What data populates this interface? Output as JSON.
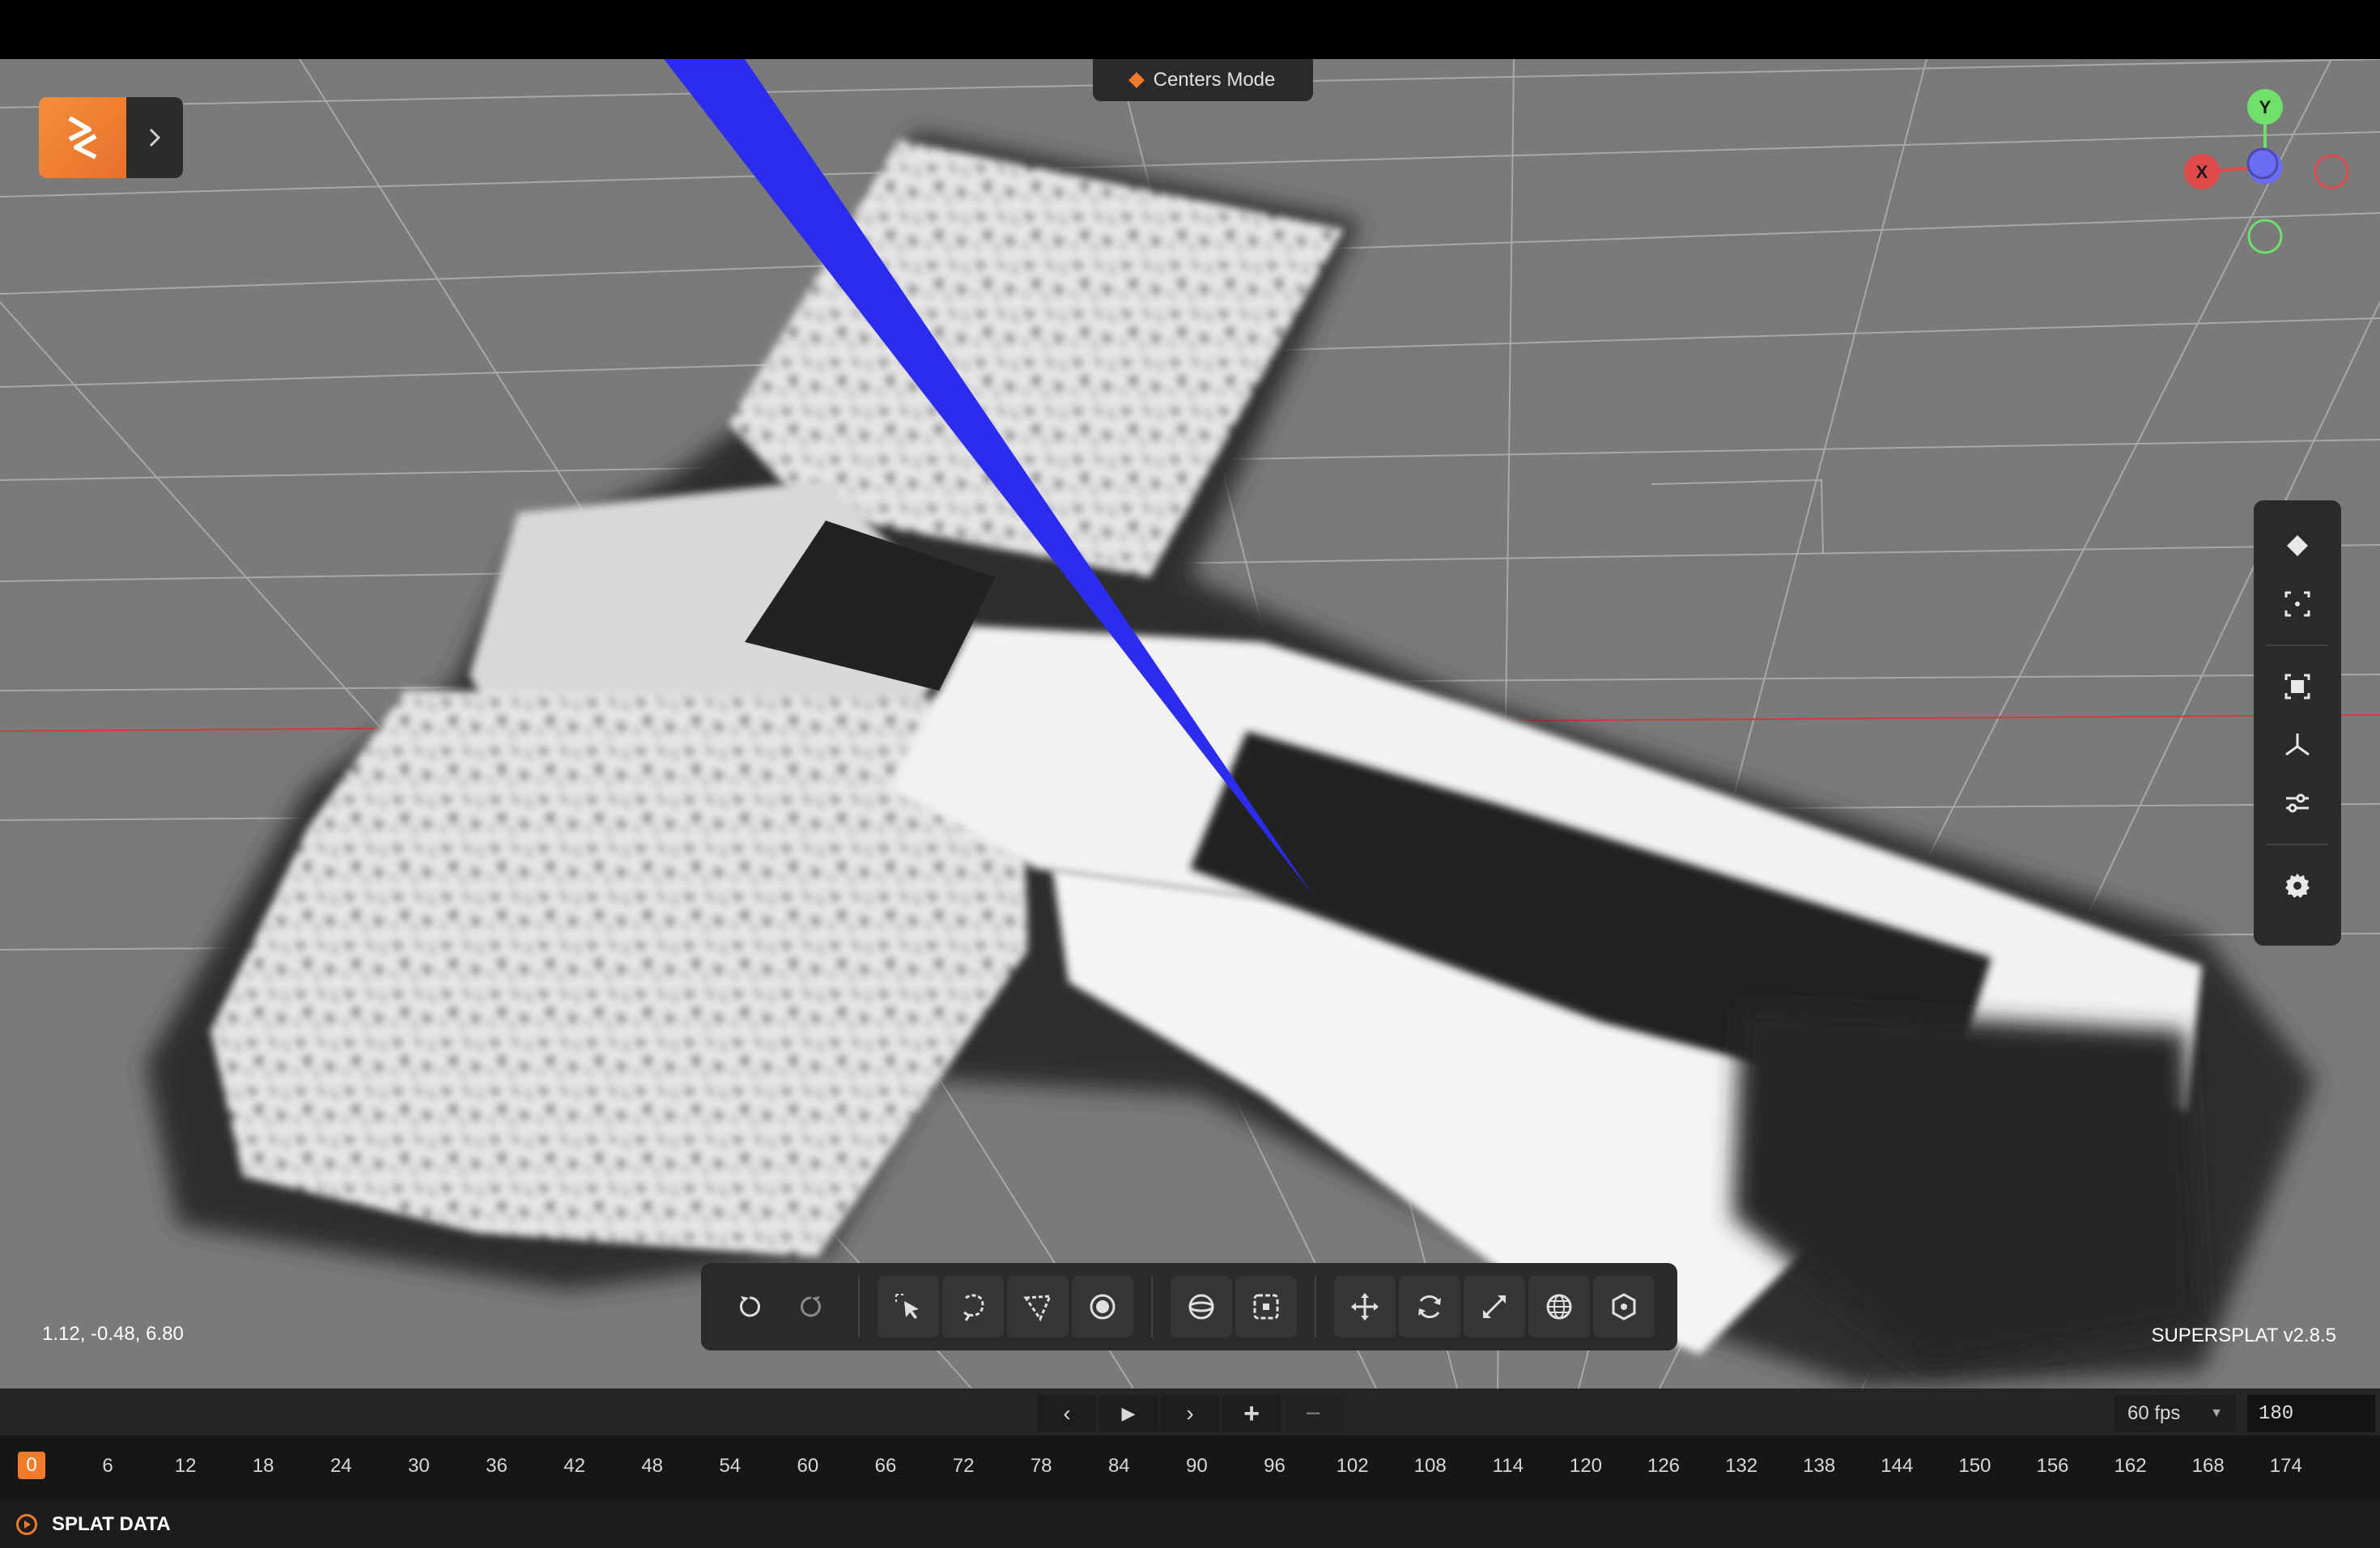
{
  "app": {
    "version_label": "SUPERSPLAT v2.8.5"
  },
  "mode": {
    "label": "Centers Mode"
  },
  "viewport": {
    "coordinates": "1.12, -0.48, 6.80"
  },
  "gizmo": {
    "x_label": "X",
    "y_label": "Y",
    "z_label": ""
  },
  "colors": {
    "accent": "#f07b2a",
    "panel": "#2a2a2a",
    "viewport_bg": "#7a7a7a",
    "ray": "#2b2cf0",
    "gizmo_x": "#e04a4a",
    "gizmo_y": "#6fe06a",
    "gizmo_z": "#6b6ef2"
  },
  "right_panel": {
    "items": [
      "keyframe-icon",
      "frame-selection-icon",
      "focus-icon",
      "axes-icon",
      "sliders-icon",
      "settings-icon"
    ]
  },
  "toolbar": {
    "items": [
      "undo-icon",
      "redo-icon",
      "pick-select-icon",
      "lasso-select-icon",
      "polygon-select-icon",
      "brush-select-icon",
      "sphere-select-icon",
      "box-select-icon",
      "translate-icon",
      "rotate-icon",
      "scale-icon",
      "world-space-icon",
      "bound-icon"
    ]
  },
  "timeline": {
    "prev_label": "‹",
    "play_label": "▶",
    "next_label": "›",
    "add_label": "+",
    "remove_label": "−",
    "fps_value": "60 fps",
    "frames_value": "180",
    "current_frame": "0",
    "ticks": [
      "6",
      "12",
      "18",
      "24",
      "30",
      "36",
      "42",
      "48",
      "54",
      "60",
      "66",
      "72",
      "78",
      "84",
      "90",
      "96",
      "102",
      "108",
      "114",
      "120",
      "126",
      "132",
      "138",
      "144",
      "150",
      "156",
      "162",
      "168",
      "174"
    ]
  },
  "splat": {
    "label": "SPLAT DATA"
  }
}
